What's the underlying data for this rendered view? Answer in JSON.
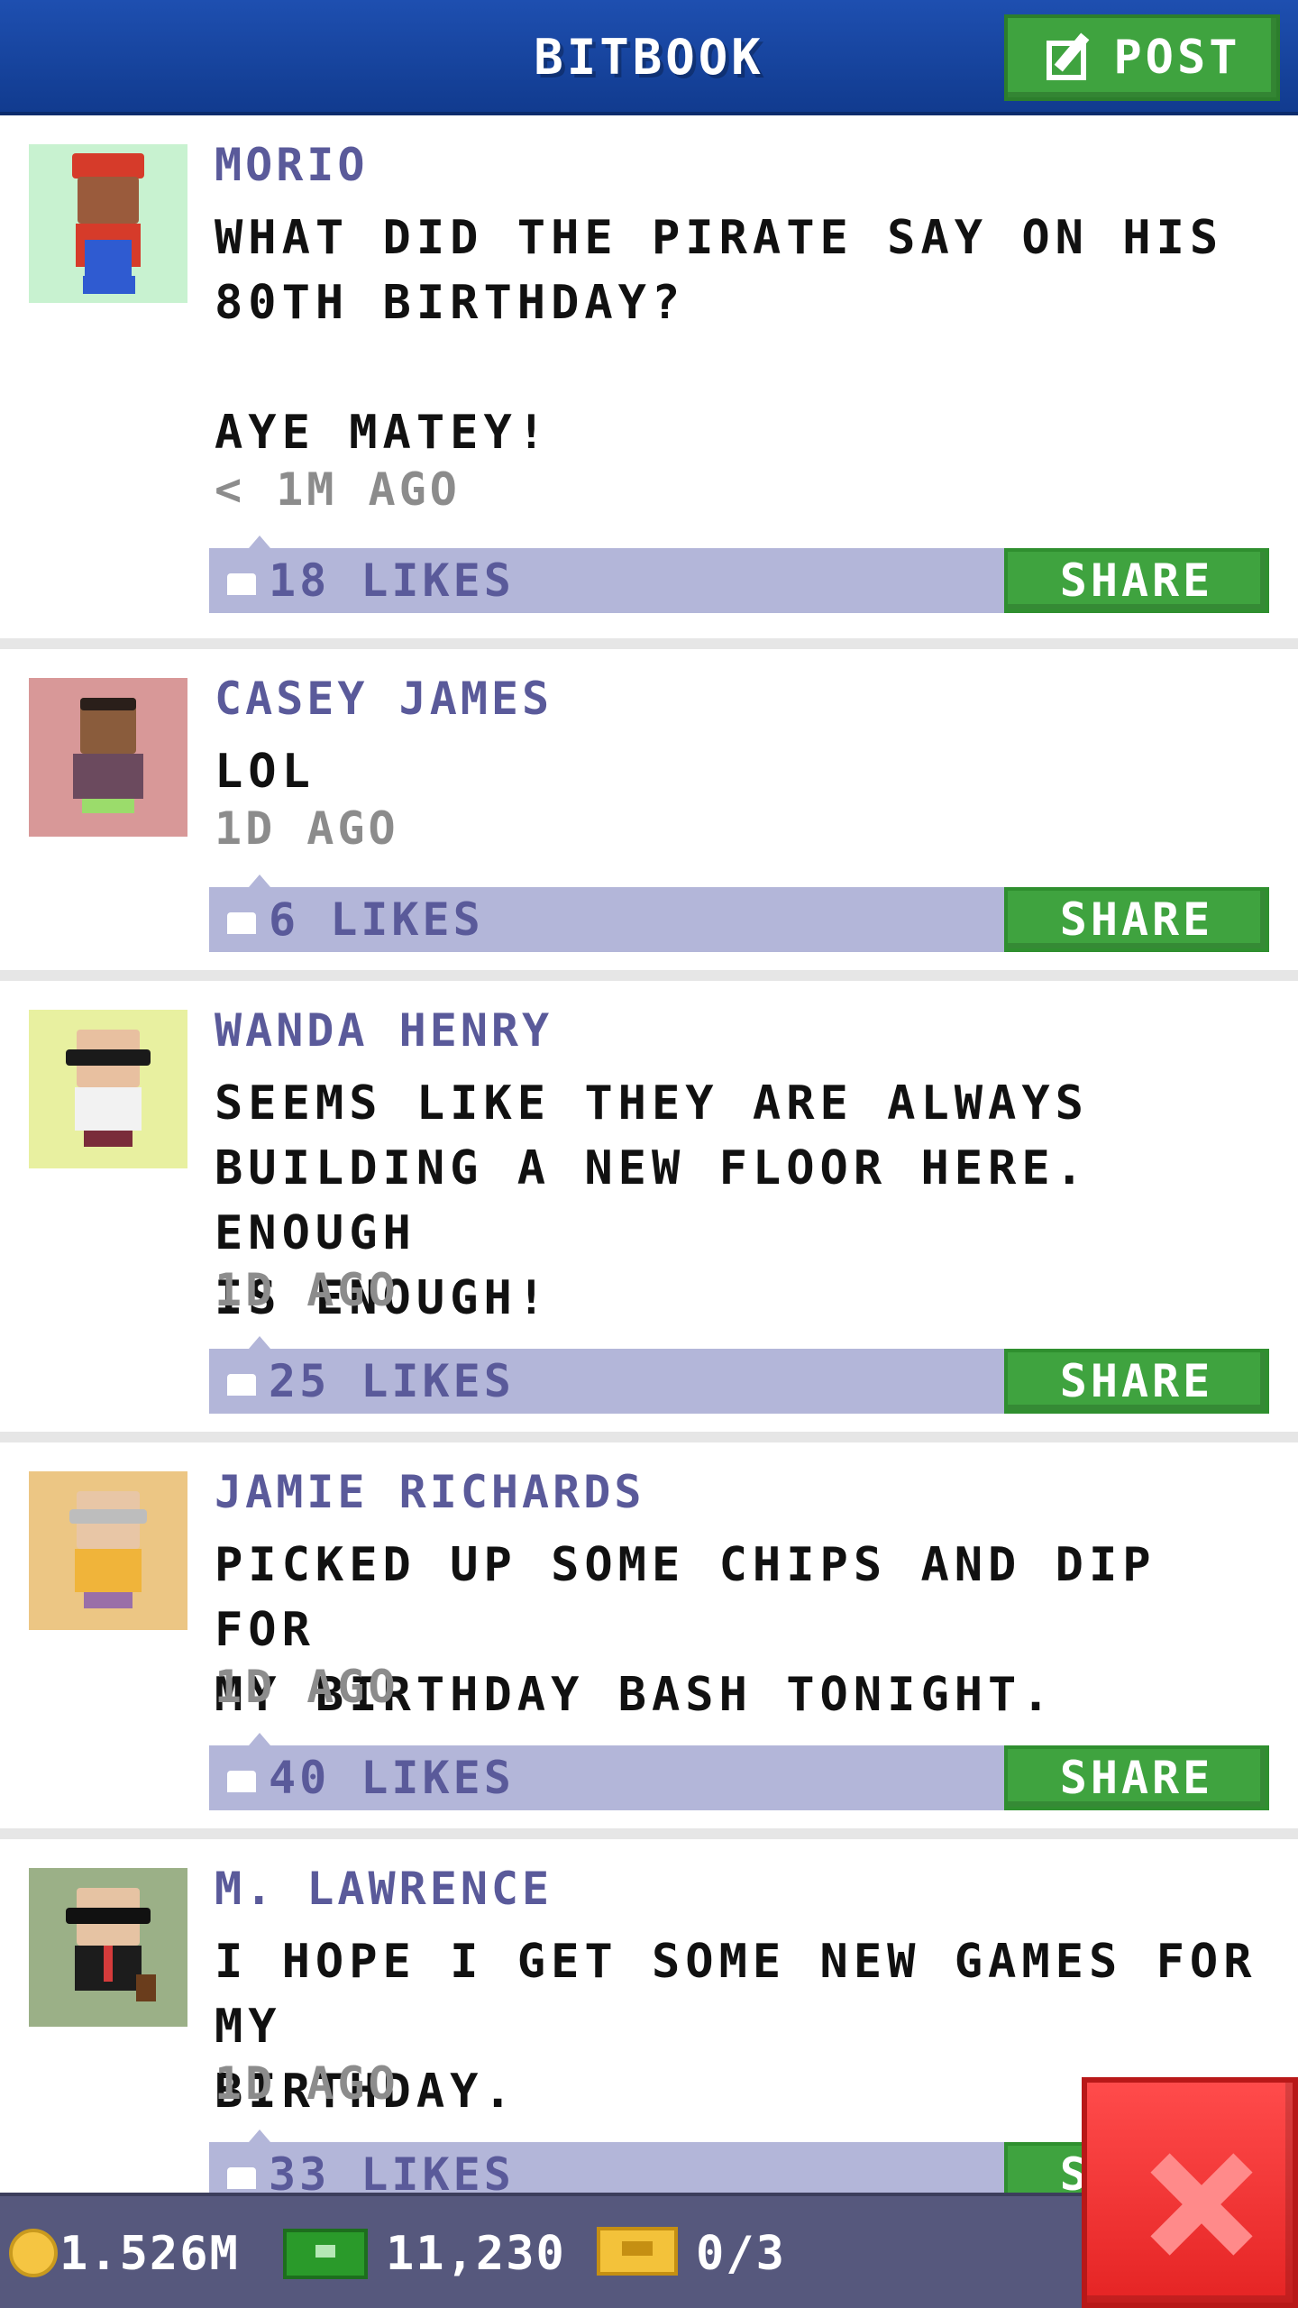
{
  "header": {
    "title": "BITBOOK",
    "post_label": "POST"
  },
  "feed": [
    {
      "author": "MORIO",
      "text": "WHAT DID THE PIRATE SAY ON HIS\n80TH BIRTHDAY?\n\nAYE MATEY!",
      "time": "< 1M AGO",
      "likes": "18 LIKES",
      "share_label": "SHARE",
      "avatar_bg": "#c8f2d0"
    },
    {
      "author": "CASEY JAMES",
      "text": "LOL",
      "time": "1D AGO",
      "likes": "6 LIKES",
      "share_label": "SHARE",
      "avatar_bg": "#d89898"
    },
    {
      "author": "WANDA HENRY",
      "text": "SEEMS LIKE THEY ARE ALWAYS\nBUILDING A NEW FLOOR HERE. ENOUGH\nIS ENOUGH!",
      "time": "1D AGO",
      "likes": "25 LIKES",
      "share_label": "SHARE",
      "avatar_bg": "#e8f0a0"
    },
    {
      "author": "JAMIE RICHARDS",
      "text": "PICKED UP SOME CHIPS AND DIP FOR\nMY BIRTHDAY BASH TONIGHT.",
      "time": "1D AGO",
      "likes": "40 LIKES",
      "share_label": "SHARE",
      "avatar_bg": "#ecc684"
    },
    {
      "author": "M. LAWRENCE",
      "text": "I HOPE I GET SOME NEW GAMES FOR MY\nBIRTHDAY.",
      "time": "1D AGO",
      "likes": "33 LIKES",
      "share_label": "SHARE",
      "avatar_bg": "#9bb087"
    }
  ],
  "bottom_bar": {
    "coins": "1.526M",
    "bux": "11,230",
    "tickets": "0/3"
  },
  "colors": {
    "header_blue": "#1e4fb0",
    "accent_green": "#3fa33f",
    "likes_bar": "#b3b6d9",
    "author_purple": "#5a5a9a",
    "close_red": "#e52424"
  }
}
